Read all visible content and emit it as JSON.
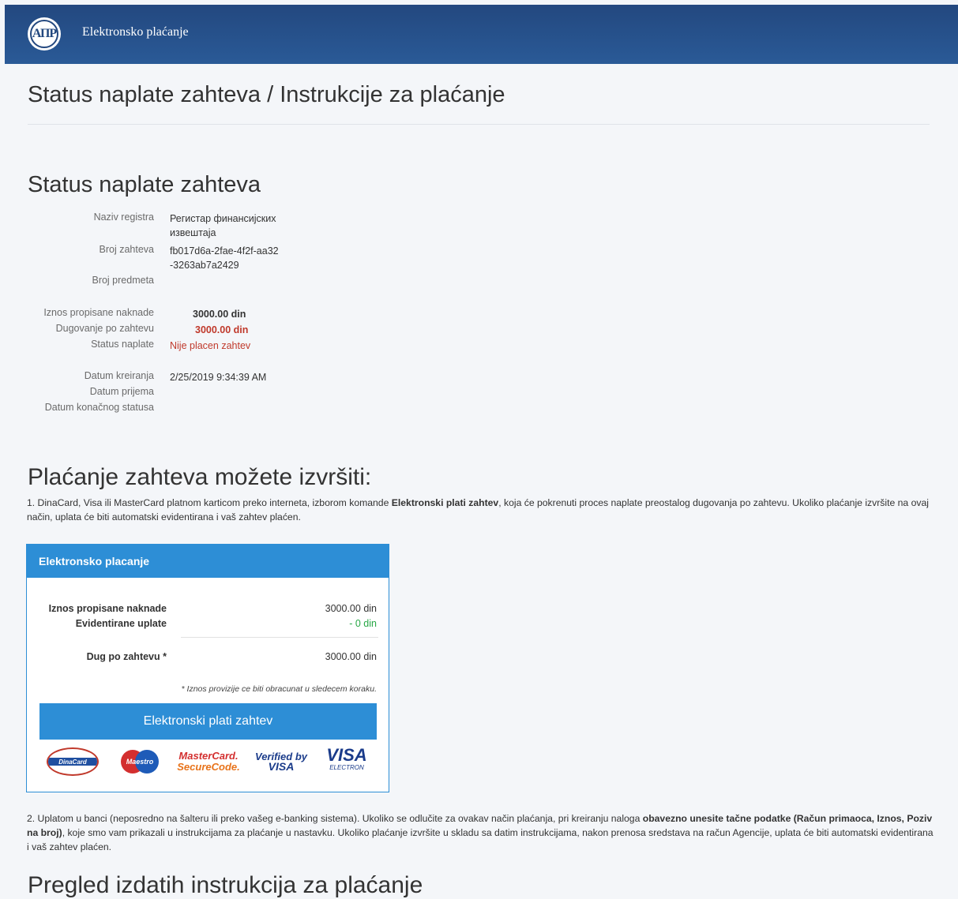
{
  "header": {
    "logo_text": "АПР",
    "app_title": "Elektronsko plaćanje"
  },
  "page": {
    "title": "Status naplate zahteva / Instrukcije za plaćanje"
  },
  "status": {
    "heading": "Status naplate zahteva",
    "naziv_registra_label": "Naziv registra",
    "naziv_registra_value": "Регистар финансијских извештаја",
    "broj_zahteva_label": "Broj zahteva",
    "broj_zahteva_value": "fb017d6a-2fae-4f2f-aa32-3263ab7a2429",
    "broj_predmeta_label": "Broj predmeta",
    "broj_predmeta_value": "",
    "iznos_label": "Iznos propisane naknade",
    "iznos_value": "3000.00 din",
    "dugovanje_label": "Dugovanje po zahtevu",
    "dugovanje_value": "3000.00 din",
    "status_label": "Status naplate",
    "status_value": "Nije placen zahtev",
    "datum_kreiranja_label": "Datum kreiranja",
    "datum_kreiranja_value": "2/25/2019 9:34:39 AM",
    "datum_prijema_label": "Datum prijema",
    "datum_prijema_value": "",
    "datum_konacnog_label": "Datum konačnog statusa",
    "datum_konacnog_value": ""
  },
  "payment": {
    "heading": "Plaćanje zahteva možete izvršiti:",
    "option1_pre": "1. DinaCard, Visa ili MasterCard platnom karticom preko interneta, izborom komande ",
    "option1_bold": "Elektronski plati zahtev",
    "option1_post": ", koja će pokrenuti proces naplate preostalog dugovanja po zahtevu. Ukoliko plaćanje izvršite na ovaj način, uplata će biti automatski evidentirana i vaš zahtev plaćen.",
    "option2_pre": "2. Uplatom u banci (neposredno na šalteru ili preko vašeg e-banking sistema). Ukoliko se odlučite za ovakav način plaćanja, pri kreiranju naloga ",
    "option2_bold": "obavezno unesite tačne podatke (Račun primaoca, Iznos, Poziv na broj)",
    "option2_post": ", koje smo vam prikazali u instrukcijama za plaćanje u nastavku. Ukoliko plaćanje izvršite u skladu sa datim instrukcijama, nakon prenosa sredstava na račun Agencije, uplata će biti automatski evidentirana i vaš zahtev plaćen."
  },
  "panel": {
    "title": "Elektronsko placanje",
    "iznos_label": "Iznos propisane naknade",
    "iznos_value": "3000.00 din",
    "evid_label": "Evidentirane uplate",
    "evid_value": "- 0 din",
    "dug_label": "Dug po zahtevu *",
    "dug_value": "3000.00 din",
    "note": "* Iznos provizije ce biti obracunat u sledecem koraku.",
    "button_label": "Elektronski plati zahtev",
    "cards": {
      "dinacard": "DinaCard",
      "maestro": "Maestro",
      "mastercard_1": "MasterCard.",
      "mastercard_2": "SecureCode.",
      "verified_1": "Verified by",
      "verified_2": "VISA",
      "visa_1": "VISA",
      "visa_2": "ELECTRON"
    },
    "colors": {
      "accent": "#2d8ed6",
      "header": "#23487f",
      "red": "#c0392b",
      "green": "#27a745"
    }
  },
  "instructions": {
    "heading": "Pregled izdatih instrukcija za plaćanje"
  }
}
